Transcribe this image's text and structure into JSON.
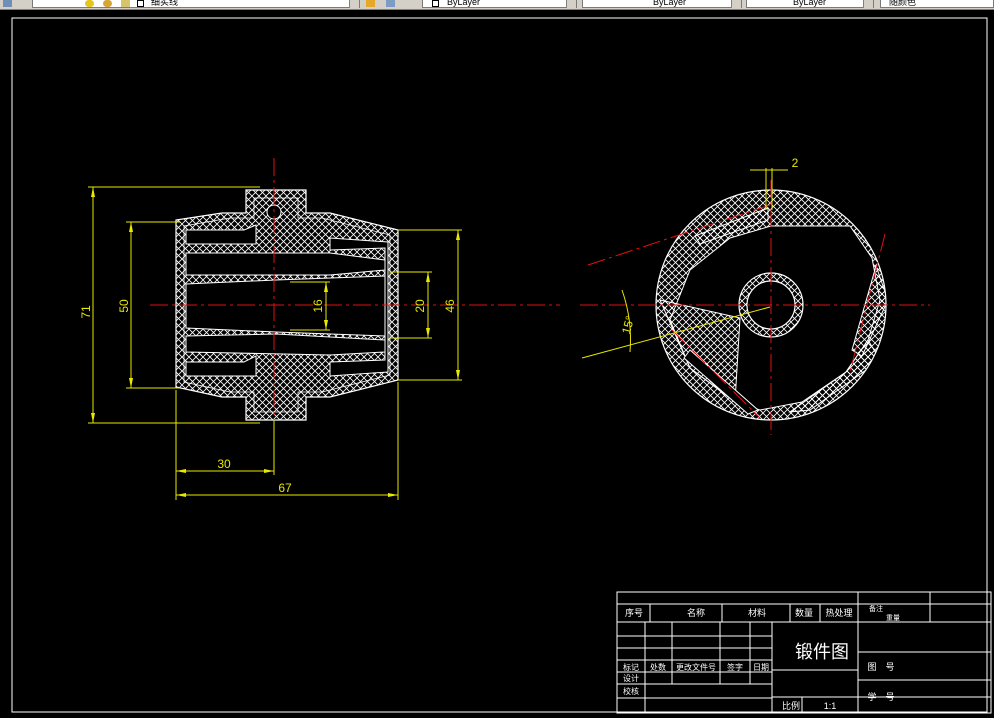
{
  "toolbar": {
    "layer_name": "细实线",
    "color_value": "ByLayer",
    "linetype_value": "ByLayer",
    "lineweight_value": "ByLayer",
    "plotstyle_value": "随颜色"
  },
  "drawing": {
    "front_view": {
      "dimensions": {
        "overall_height": "71",
        "flange_diameter": "50",
        "bore_diameter": "16",
        "inner_diameter": "20",
        "outer_diameter": "46",
        "half_length": "30",
        "overall_length": "67"
      }
    },
    "side_view": {
      "dimensions": {
        "slot_width": "2",
        "slot_angle": "15°"
      }
    },
    "title_block": {
      "headers": [
        "序号",
        "名称",
        "材料",
        "数量",
        "热处理",
        "备注"
      ],
      "extra_label": "重量",
      "drawing_title": "锻件图",
      "revision_headers": [
        "标记",
        "处数",
        "更改文件号",
        "签字",
        "日期"
      ],
      "designed_by": "设计",
      "checked_by": "校核",
      "drawing_no_label": "图　号",
      "scale_label": "比例",
      "scale_value": "1:1",
      "student_no_label": "学　号"
    }
  }
}
